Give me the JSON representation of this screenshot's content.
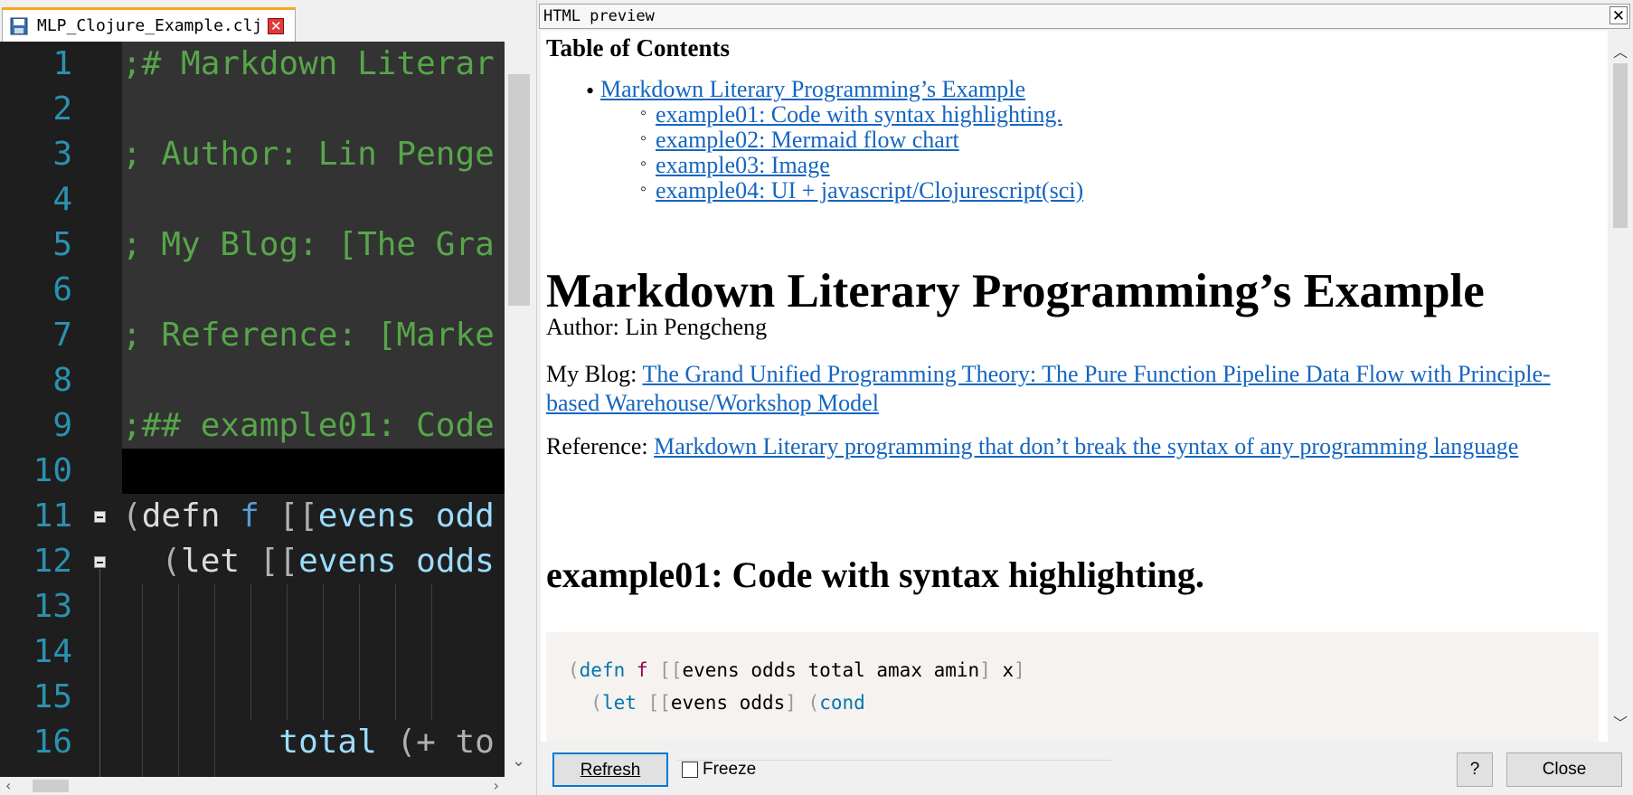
{
  "editor": {
    "tab_title": "MLP_Clojure_Example.clj",
    "tab_close_glyph": "✕",
    "line_numbers": [
      "1",
      "2",
      "3",
      "4",
      "5",
      "6",
      "7",
      "8",
      "9",
      "10",
      "11",
      "12",
      "13",
      "14",
      "15",
      "16"
    ],
    "lines": [
      ";# Markdown Literar",
      "",
      "; Author: Lin Penge",
      "",
      "; My Blog: [The Gra",
      "",
      "; Reference: [Marke",
      "",
      ";## example01: Code",
      "",
      "",
      "",
      "",
      "",
      "",
      ""
    ],
    "line11": {
      "open": "(",
      "kw": "defn",
      "name": " f ",
      "bracket": "[[",
      "sym": "evens odd"
    },
    "line12": {
      "indent": "  ",
      "open": "(",
      "kw": "let",
      "bracket": " [[",
      "sym": "evens odds"
    },
    "line16": {
      "indent": "        ",
      "sym": "total",
      "rest": " (+ to"
    }
  },
  "preview": {
    "header_title": "HTML preview",
    "toc_title": "Table of Contents",
    "toc": [
      {
        "level": 1,
        "text": "Markdown Literary Programming’s Example"
      },
      {
        "level": 2,
        "text": "example01: Code with syntax highlighting."
      },
      {
        "level": 2,
        "text": "example02: Mermaid flow chart"
      },
      {
        "level": 2,
        "text": "example03: Image"
      },
      {
        "level": 2,
        "text": "example04: UI + javascript/Clojurescript(sci)"
      }
    ],
    "h1": "Markdown Literary Programming’s Example",
    "author": "Author: Lin Pengcheng",
    "blog_label": "My Blog: ",
    "blog_link": "The Grand Unified Programming Theory: The Pure Function Pipeline Data Flow with Principle-based Warehouse/Workshop Model",
    "reference_label": "Reference: ",
    "reference_link": "Markdown Literary programming that don’t break the syntax of any programming language",
    "h2": "example01: Code with syntax highlighting.",
    "code": {
      "line1": {
        "p1": "(",
        "kw": "defn",
        "fn": " f",
        "p2": " [[",
        "txt": "evens odds total amax amin",
        "p3": "]",
        "txt2": " x",
        "p4": "]"
      },
      "line2": {
        "p1": "  (",
        "kw": "let",
        "p2": " [[",
        "txt": "evens odds",
        "p3": "]",
        "p4": " (",
        "kw2": "cond"
      }
    }
  },
  "footer": {
    "refresh": "Refresh",
    "freeze": "Freeze",
    "help": "?",
    "close": "Close"
  },
  "colors": {
    "editor_bg": "#1e1e1e",
    "line_number": "#2b91af",
    "comment": "#57a64a",
    "link": "#1565c0",
    "tab_accent": "#f7a71b"
  }
}
